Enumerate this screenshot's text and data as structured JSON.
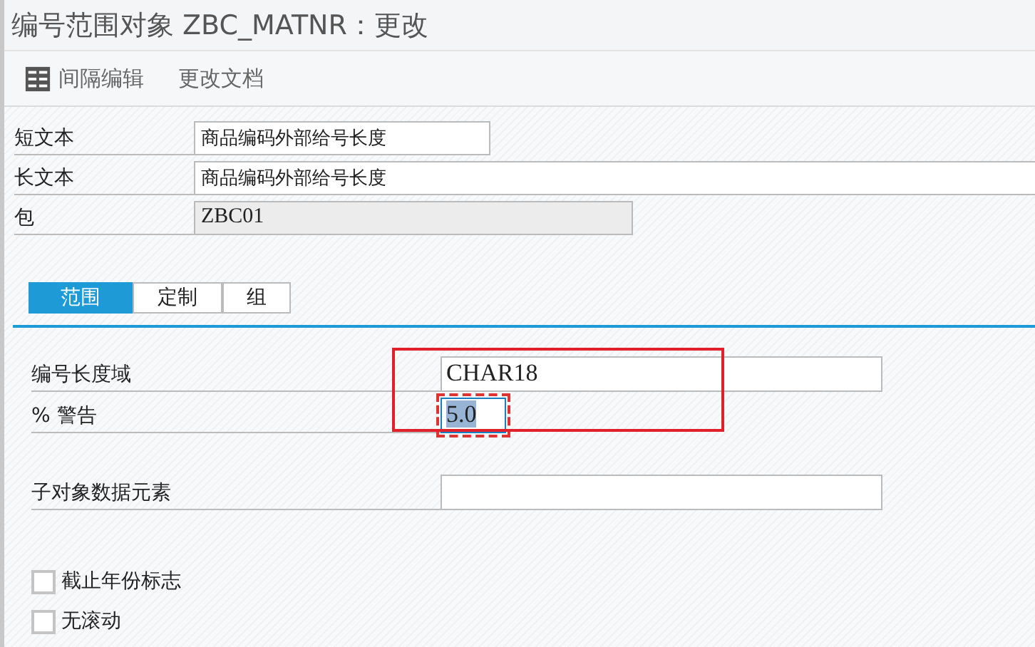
{
  "window": {
    "title": "编号范围对象 ZBC_MATNR：更改"
  },
  "toolbar": [
    {
      "label": "间隔编辑",
      "kind": "icon"
    },
    {
      "label": "更改文档",
      "kind": "text"
    }
  ],
  "header_fields": [
    {
      "label": "短文本",
      "value": "商品编码外部给号长度",
      "kind": "short",
      "readonly": false
    },
    {
      "label": "长文本",
      "value": "商品编码外部给号长度",
      "kind": "long",
      "readonly": false
    },
    {
      "label": "包",
      "value": "ZBC01",
      "kind": "medium",
      "readonly": true
    }
  ],
  "tabs": [
    {
      "label": "范围",
      "selected": true
    },
    {
      "label": "定制",
      "selected": false
    },
    {
      "label": "组",
      "selected": false
    }
  ],
  "highlighted_fields": [
    {
      "label": "编号长度域",
      "value": "CHAR18",
      "kind": "long",
      "focused": false
    },
    {
      "label": "% 警告",
      "value": "5.0",
      "kind": "tiny",
      "focused": true
    }
  ],
  "fields": [
    {
      "label": "子对象数据元素",
      "kind": "long",
      "focused": false
    }
  ],
  "checkboxes": [
    {
      "label": "截止年份标志",
      "checked": false
    },
    {
      "label": "无滚动",
      "checked": false
    }
  ]
}
